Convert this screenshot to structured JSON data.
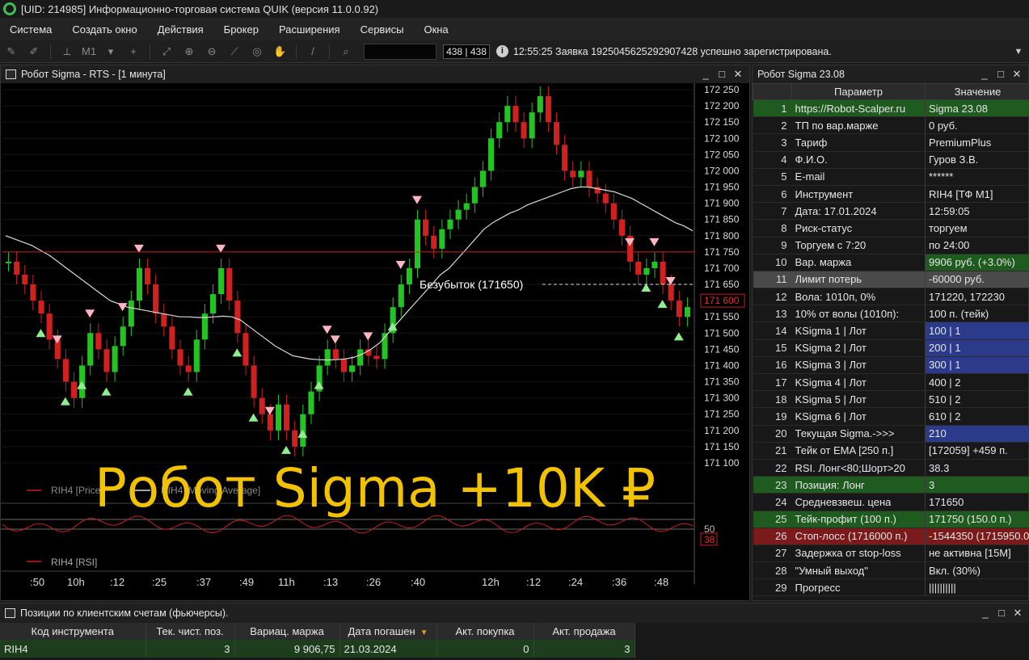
{
  "window": {
    "title": "[UID: 214985] Информационно-торговая система QUIK (версия 11.0.0.92)"
  },
  "menu": [
    "Система",
    "Создать окно",
    "Действия",
    "Брокер",
    "Расширения",
    "Сервисы",
    "Окна"
  ],
  "toolbar": {
    "interval": "M1",
    "counter": "438 | 438",
    "message": "12:55:25  Заявка 1925045625292907428 успешно зарегистрирована."
  },
  "chart_window": {
    "title": "Робот Sigma - RTS   - [1 минута]",
    "overlay_text": "Робот Sigma +10K ₽",
    "breakeven_label": "Безубыток (171650)",
    "legend_price": "RIH4 [Price]",
    "legend_ma": "RIH4 [Moving Average]",
    "legend_rsi": "RIH4 [RSI]",
    "rsi_ticks": [
      "50",
      "38"
    ],
    "time_labels": [
      ":50",
      "10h",
      ":12",
      ":25",
      ":37",
      ":49",
      "11h",
      ":13",
      ":26",
      ":40",
      "12h",
      ":12",
      ":24",
      ":36",
      ":48"
    ]
  },
  "chart_data": {
    "type": "line",
    "series": [
      {
        "name": "RIH4 [Price]",
        "values": [
          171720,
          171680,
          171650,
          171600,
          171560,
          171480,
          171420,
          171350,
          171300,
          171400,
          171500,
          171450,
          171380,
          171460,
          171520,
          171600,
          171700,
          171650,
          171560,
          171520,
          171450,
          171400,
          171380,
          171480,
          171560,
          171620,
          171700,
          171600,
          171500,
          171400,
          171300,
          171250,
          171200,
          171280,
          171200,
          171150,
          171250,
          171320,
          171400,
          171450,
          171420,
          171380,
          171400,
          171450,
          171430,
          171420,
          171500,
          171580,
          171650,
          171700,
          171850,
          171800,
          171760,
          171820,
          171850,
          171880,
          171900,
          171950,
          172000,
          172100,
          172150,
          172200,
          172150,
          172100,
          172180,
          172230,
          172150,
          172080,
          172000,
          171980,
          172000,
          171950,
          171930,
          171900,
          171850,
          171800,
          171720,
          171680,
          171700,
          171720,
          171650,
          171600,
          171550,
          171580
        ]
      },
      {
        "name": "RIH4 [Moving Average]",
        "values": [
          171800,
          171790,
          171780,
          171770,
          171755,
          171740,
          171720,
          171700,
          171680,
          171660,
          171640,
          171620,
          171600,
          171590,
          171580,
          171575,
          171570,
          171565,
          171560,
          171555,
          171550,
          171550,
          171548,
          171548,
          171550,
          171552,
          171550,
          171540,
          171520,
          171500,
          171480,
          171460,
          171445,
          171430,
          171425,
          171420,
          171418,
          171417,
          171418,
          171420,
          171425,
          171435,
          171450,
          171470,
          171500,
          171530,
          171560,
          171590,
          171620,
          171650,
          171680,
          171700,
          171730,
          171760,
          171790,
          171820,
          171840,
          171855,
          171870,
          171880,
          171895,
          171905,
          171915,
          171925,
          171935,
          171945,
          171950,
          171950,
          171945,
          171940,
          171935,
          171925,
          171915,
          171900,
          171885,
          171870,
          171855,
          171840,
          171830,
          171815
        ]
      }
    ],
    "ylim": [
      171100,
      172250
    ],
    "y_ticks": [
      "172 250",
      "172 200",
      "172 150",
      "172 100",
      "172 050",
      "172 000",
      "171 950",
      "171 900",
      "171 850",
      "171 800",
      "171 750",
      "171 700",
      "171 650",
      "171 600",
      "171 550",
      "171 500",
      "171 450",
      "171 400",
      "171 350",
      "171 300",
      "171 250",
      "171 200",
      "171 150",
      "171 100"
    ],
    "current_price": "171 600",
    "take_profit_line": 171750,
    "breakeven_line": 171650,
    "colors": {
      "up": "#22c322",
      "down": "#d02020",
      "ma": "#d8d8d8",
      "tp_line": "#c81e1e",
      "buy_marker": "#90ee90",
      "sell_marker": "#ffb6c1"
    }
  },
  "params_window": {
    "title": "Робот Sigma 23.08",
    "col_param": "Параметр",
    "col_value": "Значение",
    "rows": [
      {
        "n": "1",
        "p": "https://Robot-Scalper.ru",
        "v": "Sigma 23.08"
      },
      {
        "n": "2",
        "p": "ТП по вар.марже",
        "v": "0 руб."
      },
      {
        "n": "3",
        "p": "Тариф",
        "v": "PremiumPlus"
      },
      {
        "n": "4",
        "p": "Ф.И.О.",
        "v": "Гуров З.В."
      },
      {
        "n": "5",
        "p": "E-mail",
        "v": "******"
      },
      {
        "n": "6",
        "p": "Инструмент",
        "v": "RIH4 [ТФ M1]"
      },
      {
        "n": "7",
        "p": "Дата: 17.01.2024",
        "v": "12:59:05"
      },
      {
        "n": "8",
        "p": "Риск-статус",
        "v": "торгуем"
      },
      {
        "n": "9",
        "p": "Торгуем с 7:20",
        "v": "по 24:00"
      },
      {
        "n": "10",
        "p": "Вар. маржа",
        "v": "9906 руб. (+3.0%)"
      },
      {
        "n": "11",
        "p": "Лимит потерь",
        "v": "-60000 руб."
      },
      {
        "n": "12",
        "p": "Вола: 1010п, 0%",
        "v": "171220, 172230"
      },
      {
        "n": "13",
        "p": "10% от волы (1010п):",
        "v": "100 п. (тейк)"
      },
      {
        "n": "14",
        "p": "KSigma 1 | Лот",
        "v": "100 | 1"
      },
      {
        "n": "15",
        "p": "KSigma 2 | Лот",
        "v": "200 | 1"
      },
      {
        "n": "16",
        "p": "KSigma 3 | Лот",
        "v": "300 | 1"
      },
      {
        "n": "17",
        "p": "KSigma 4 | Лот",
        "v": "400 | 2"
      },
      {
        "n": "18",
        "p": "KSigma 5 | Лот",
        "v": "510 | 2"
      },
      {
        "n": "19",
        "p": "KSigma 6 | Лот",
        "v": "610 | 2"
      },
      {
        "n": "20",
        "p": "Текущая Sigma.->>>",
        "v": "210"
      },
      {
        "n": "21",
        "p": "Тейк от EMA [250 п.]",
        "v": "[172059] +459 п."
      },
      {
        "n": "22",
        "p": "RSI. Лонг<80;Шорт>20",
        "v": "38.3"
      },
      {
        "n": "23",
        "p": "Позиция: Лонг",
        "v": "3"
      },
      {
        "n": "24",
        "p": "Средневзвеш. цена",
        "v": "171650"
      },
      {
        "n": "25",
        "p": "Тейк-профит (100 п.)",
        "v": "171750 (150.0 п.)"
      },
      {
        "n": "26",
        "p": "Стоп-лосс (1716000 п.)",
        "v": "-1544350 (1715950.0"
      },
      {
        "n": "27",
        "p": "Задержка от stop-loss",
        "v": "не активна [15M]"
      },
      {
        "n": "28",
        "p": "\"Умный выход\"",
        "v": "Вкл. (30%)"
      },
      {
        "n": "29",
        "p": "Прогресс",
        "v": "||||||||||"
      }
    ]
  },
  "positions_window": {
    "title": "Позиции по клиентским счетам (фьючерсы).",
    "columns": [
      "Код инструмента",
      "Тек. чист. поз.",
      "Вариац. маржа",
      "Дата погашен",
      "Акт. покупка",
      "Акт. продажа"
    ],
    "row": [
      "RIH4",
      "3",
      "9 906,75",
      "21.03.2024",
      "0",
      "3"
    ]
  }
}
